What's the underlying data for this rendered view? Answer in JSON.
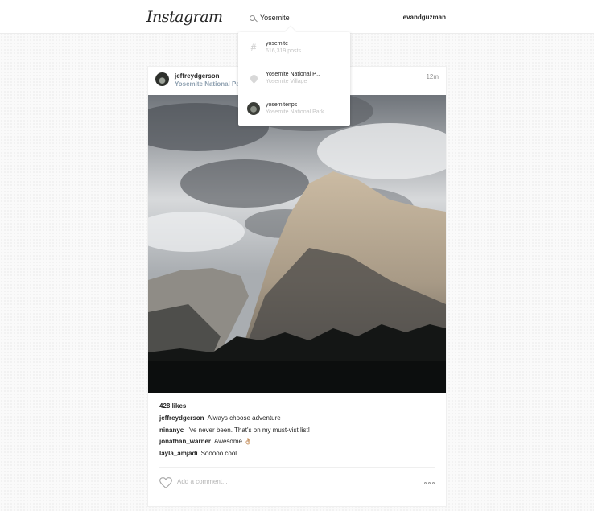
{
  "header": {
    "logo_text": "Instagram",
    "search_value": "Yosemite",
    "username": "evandguzman"
  },
  "search_results": [
    {
      "type": "hashtag",
      "icon": "hashtag-icon",
      "title": "yosemite",
      "subtitle": "616,319 posts"
    },
    {
      "type": "place",
      "icon": "location-pin-icon",
      "title": "Yosemite National P...",
      "subtitle": "Yosemite Village"
    },
    {
      "type": "user",
      "icon": "avatar",
      "title": "yosemitenps",
      "subtitle": "Yosemite National Park"
    }
  ],
  "post": {
    "username": "jeffreydgerson",
    "location": "Yosemite National Park",
    "time": "12m",
    "likes": "428 likes",
    "comments": [
      {
        "user": "jeffreydgerson",
        "text": "Always choose adventure"
      },
      {
        "user": "ninanyc",
        "text": "I've never been. That's on my must-vist list!"
      },
      {
        "user": "jonathan_warner",
        "text": "Awesome 👌🏼"
      },
      {
        "user": "layla_amjadi",
        "text": "Sooooo cool"
      }
    ],
    "add_comment_placeholder": "Add a comment..."
  },
  "colors": {
    "location_text": "#8ea0b0",
    "muted_text": "#c4c4c4",
    "time_text": "#8e8e8e"
  }
}
